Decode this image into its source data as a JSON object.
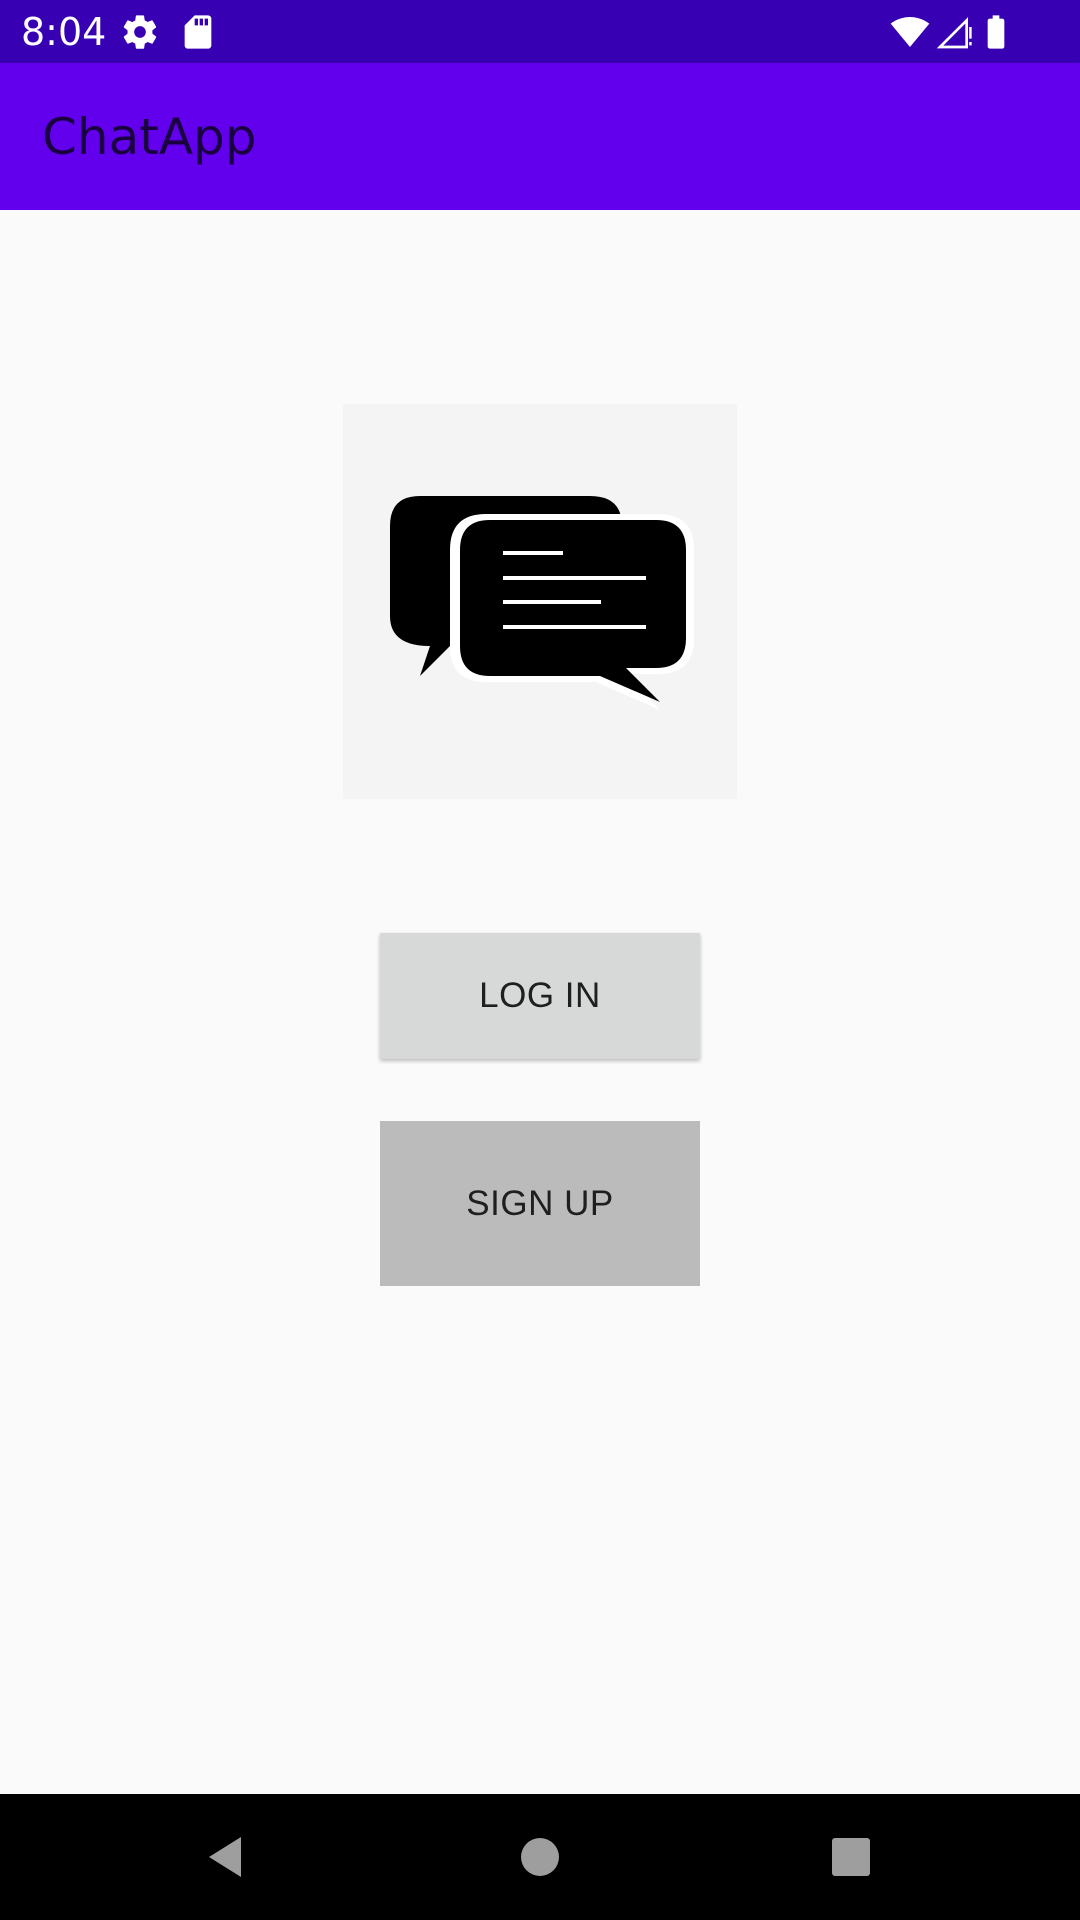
{
  "status_bar": {
    "time": "8:04",
    "icons": [
      "gear-icon",
      "sd-card-icon",
      "wifi-icon",
      "signal-icon",
      "battery-icon"
    ],
    "background": "#3700b3"
  },
  "app_bar": {
    "title": "ChatApp",
    "background": "#6200ee"
  },
  "main": {
    "logo_icon": "chat-bubbles-icon",
    "login_label": "LOG IN",
    "signup_label": "SIGN UP"
  },
  "nav_bar": {
    "icons": [
      "back-icon",
      "home-icon",
      "recents-icon"
    ]
  }
}
